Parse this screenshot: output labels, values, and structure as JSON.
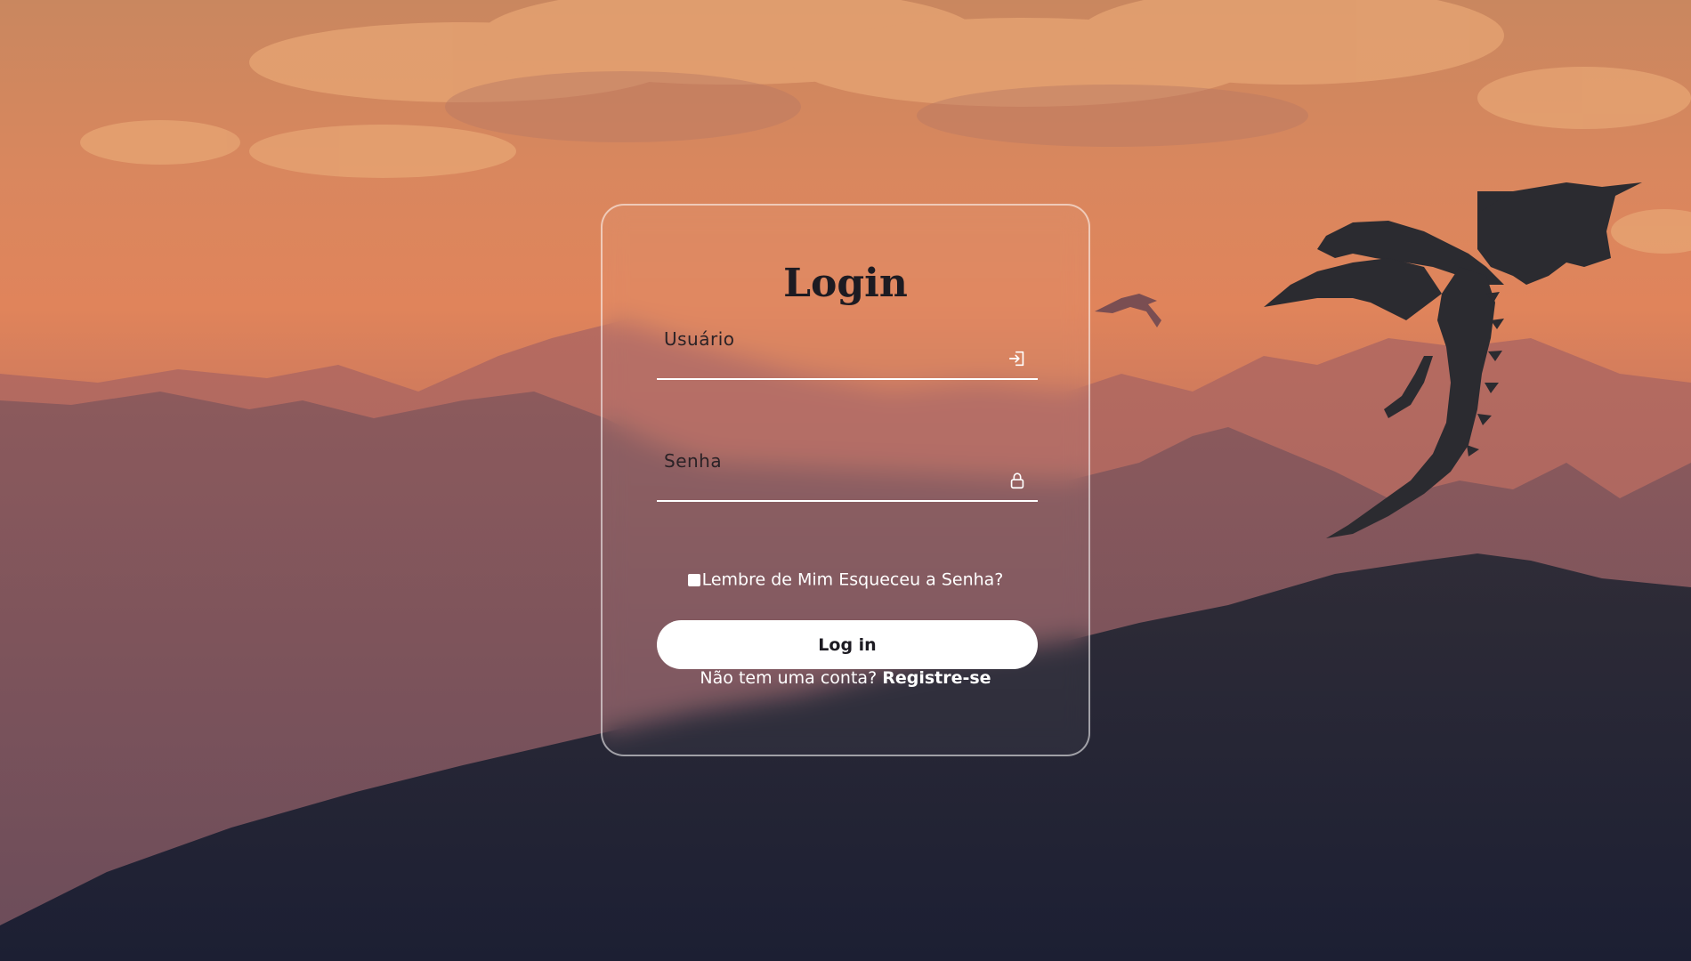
{
  "login": {
    "title": "Login",
    "username_label": "Usuário",
    "password_label": "Senha",
    "remember_label": "Lembre de Mim",
    "forgot_label": "Esqueceu a Senha?",
    "button_label": "Log in",
    "no_account_text": "Não tem uma conta?",
    "register_label": "Registre-se"
  },
  "icons": {
    "username": "login-arrow-icon",
    "password": "lock-icon"
  },
  "colors": {
    "card_border": "#ffffff",
    "button_bg": "#ffffff",
    "title_text": "#1d1b22"
  }
}
